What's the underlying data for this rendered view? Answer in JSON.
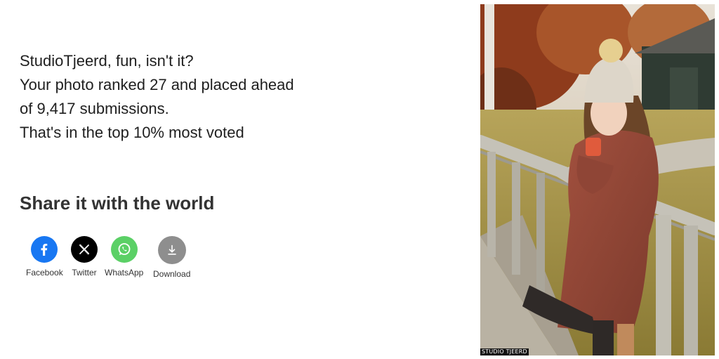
{
  "message": {
    "line1": "StudioTjeerd, fun, isn't it?",
    "line2": "Your photo ranked 27 and placed ahead",
    "line3": "of 9,417 submissions.",
    "line4": "That's in the top 10% most voted"
  },
  "share": {
    "title": "Share it with the world",
    "buttons": [
      {
        "label": "Facebook",
        "icon": "facebook-icon",
        "color": "#1877F2"
      },
      {
        "label": "Twitter",
        "icon": "x-icon",
        "color": "#000000"
      },
      {
        "label": "WhatsApp",
        "icon": "whatsapp-icon",
        "color": "#5BD066"
      },
      {
        "label": "Download",
        "icon": "download-icon",
        "color": "#8E8E8E"
      }
    ]
  },
  "photo": {
    "watermark": "STUDIO TJEERD"
  }
}
